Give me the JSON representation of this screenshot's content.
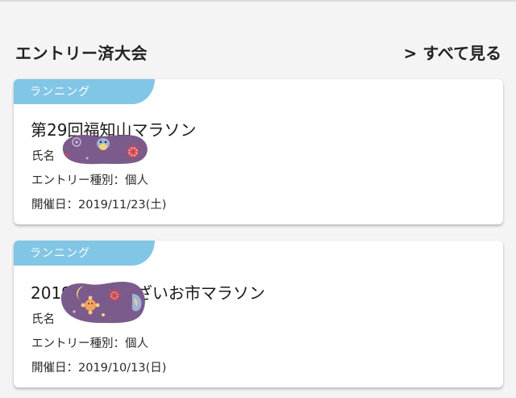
{
  "section": {
    "title": "エントリー済大会",
    "see_all_label": "> すべて見る"
  },
  "entries": [
    {
      "category": "ランニング",
      "event_name": "第29回福知山マラソン",
      "name_label": "氏名",
      "entry_type": "エントリー種別：個人",
      "date": "開催日：2019/11/23(土)"
    },
    {
      "category": "ランニング",
      "event_name": "2019長浜市あざいお市マラソン",
      "name_label": "氏名",
      "entry_type": "エントリー種別：個人",
      "date": "開催日：2019/10/13(日)"
    }
  ],
  "colors": {
    "tag": "#82c6e6",
    "card": "#ffffff",
    "background": "#f4f4f4",
    "sticker": "#7b5a8c"
  }
}
